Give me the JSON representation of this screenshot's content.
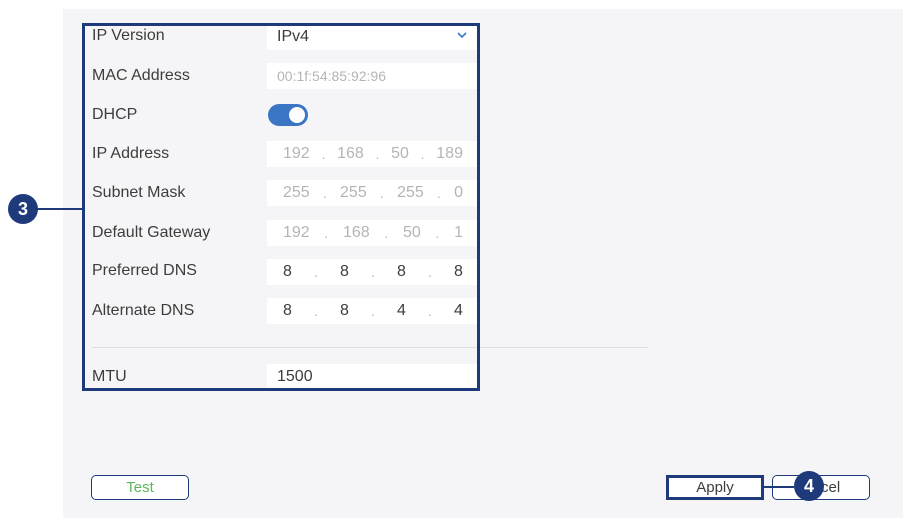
{
  "form": {
    "ip_version": {
      "label": "IP Version",
      "value": "IPv4"
    },
    "mac_address": {
      "label": "MAC Address",
      "value": "00:1f:54:85:92:96"
    },
    "dhcp": {
      "label": "DHCP",
      "enabled": true
    },
    "ip_address": {
      "label": "IP Address",
      "octets": [
        "192",
        "168",
        "50",
        "189"
      ]
    },
    "subnet_mask": {
      "label": "Subnet Mask",
      "octets": [
        "255",
        "255",
        "255",
        "0"
      ]
    },
    "default_gateway": {
      "label": "Default Gateway",
      "octets": [
        "192",
        "168",
        "50",
        "1"
      ]
    },
    "preferred_dns": {
      "label": "Preferred DNS",
      "octets": [
        "8",
        "8",
        "8",
        "8"
      ]
    },
    "alternate_dns": {
      "label": "Alternate DNS",
      "octets": [
        "8",
        "8",
        "4",
        "4"
      ]
    },
    "mtu": {
      "label": "MTU",
      "value": "1500"
    }
  },
  "buttons": {
    "test": "Test",
    "apply": "Apply",
    "cancel_visible": "cel"
  },
  "callouts": {
    "fields": "3",
    "apply": "4"
  },
  "ip_separator": ".",
  "colors": {
    "accent": "#1f3a7a",
    "toggle_on": "#3a76c4",
    "test_text": "#5cb85c",
    "panel_bg": "#f5f5f7"
  }
}
